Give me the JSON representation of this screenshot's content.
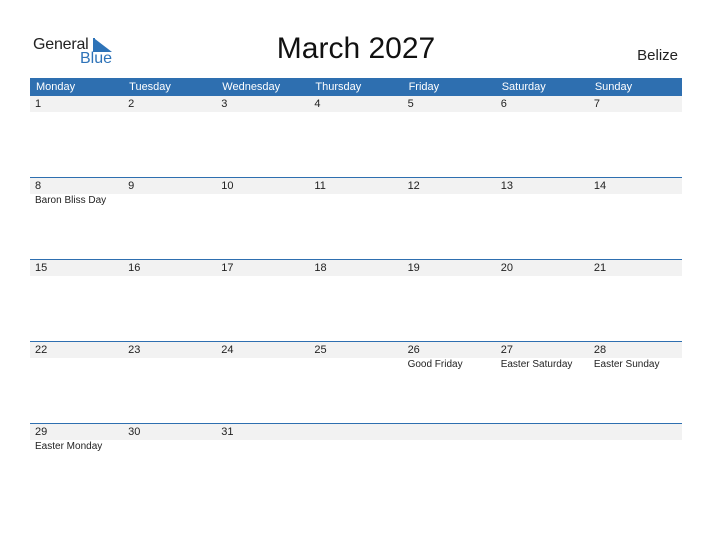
{
  "logo": {
    "general": "General",
    "blue": "Blue"
  },
  "title": "March 2027",
  "country": "Belize",
  "colors": {
    "header_bg": "#2e6fb0",
    "date_row_bg": "#f2f2f2",
    "accent": "#2e73b8"
  },
  "weekdays": [
    "Monday",
    "Tuesday",
    "Wednesday",
    "Thursday",
    "Friday",
    "Saturday",
    "Sunday"
  ],
  "weeks": [
    {
      "dates": [
        "1",
        "2",
        "3",
        "4",
        "5",
        "6",
        "7"
      ],
      "holidays": [
        "",
        "",
        "",
        "",
        "",
        "",
        ""
      ]
    },
    {
      "dates": [
        "8",
        "9",
        "10",
        "11",
        "12",
        "13",
        "14"
      ],
      "holidays": [
        "Baron Bliss Day",
        "",
        "",
        "",
        "",
        "",
        ""
      ]
    },
    {
      "dates": [
        "15",
        "16",
        "17",
        "18",
        "19",
        "20",
        "21"
      ],
      "holidays": [
        "",
        "",
        "",
        "",
        "",
        "",
        ""
      ]
    },
    {
      "dates": [
        "22",
        "23",
        "24",
        "25",
        "26",
        "27",
        "28"
      ],
      "holidays": [
        "",
        "",
        "",
        "",
        "Good Friday",
        "Easter Saturday",
        "Easter Sunday"
      ]
    },
    {
      "dates": [
        "29",
        "30",
        "31",
        "",
        "",
        "",
        ""
      ],
      "holidays": [
        "Easter Monday",
        "",
        "",
        "",
        "",
        "",
        ""
      ]
    }
  ]
}
